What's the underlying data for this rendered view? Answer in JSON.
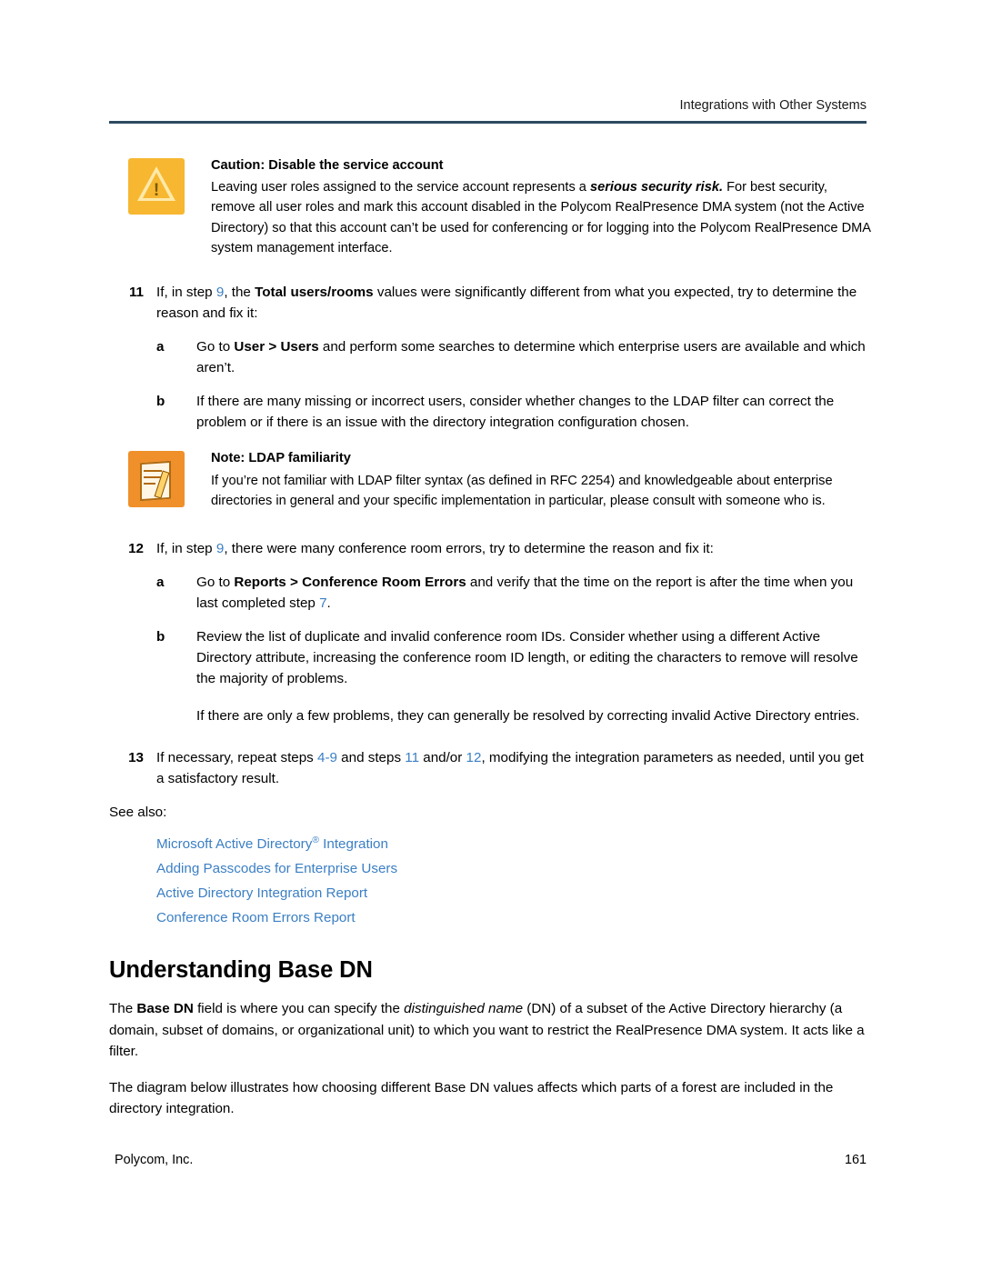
{
  "header": {
    "running_head": "Integrations with Other Systems"
  },
  "caution": {
    "icon": "warning-triangle-icon",
    "title": "Caution: Disable the service account",
    "body_1": "Leaving user roles assigned to the service account represents a ",
    "body_emph": "serious security risk.",
    "body_2": " For best security, remove all user roles and mark this account disabled in the Polycom RealPresence DMA system (not the Active Directory) so that this account can’t be used for conferencing or for logging into the Polycom RealPresence DMA system management interface."
  },
  "steps": {
    "s11": {
      "num": "11",
      "t1": "If, in step ",
      "xref": "9",
      "t2": ", the ",
      "bold": "Total users/rooms",
      "t3": " values were significantly different from what you expected, try to determine the reason and fix it:",
      "a": {
        "letter": "a",
        "t1": "Go to ",
        "bold": "User > Users",
        "t2": " and perform some searches to determine which enterprise users are available and which aren’t."
      },
      "b": {
        "letter": "b",
        "text": "If there are many missing or incorrect users, consider whether changes to the LDAP filter can correct the problem or if there is an issue with the directory integration configuration chosen."
      }
    },
    "s12": {
      "num": "12",
      "t1": "If, in step ",
      "xref": "9",
      "t2": ", there were many conference room errors, try to determine the reason and fix it:",
      "a": {
        "letter": "a",
        "t1": "Go to ",
        "bold": "Reports > Conference Room Errors",
        "t2": " and verify that the time on the report is after the time when you last completed step ",
        "xref": "7",
        "t3": "."
      },
      "b": {
        "letter": "b",
        "text": "Review the list of duplicate and invalid conference room IDs. Consider whether using a different Active Directory attribute, increasing the conference room ID length, or editing the characters to remove will resolve the majority of problems."
      },
      "extra": "If there are only a few problems, they can generally be resolved by correcting invalid Active Directory entries."
    },
    "s13": {
      "num": "13",
      "t1": "If necessary, repeat steps ",
      "xref1": "4-9",
      "t2": " and steps ",
      "xref2": "11",
      "t3": " and/or ",
      "xref3": "12",
      "t4": ", modifying the integration parameters as needed, until you get a satisfactory result."
    }
  },
  "note": {
    "icon": "note-pencil-icon",
    "title": "Note: LDAP familiarity",
    "body": "If you’re not familiar with LDAP filter syntax (as defined in RFC 2254) and knowledgeable about enterprise directories in general and your specific implementation in particular, please consult with someone who is."
  },
  "see_also": {
    "label": "See also:",
    "links": [
      {
        "text_1": "Microsoft Active Directory",
        "sup": "®",
        "text_2": " Integration"
      },
      {
        "text_1": "Adding Passcodes for Enterprise Users",
        "sup": "",
        "text_2": ""
      },
      {
        "text_1": "Active Directory Integration Report",
        "sup": "",
        "text_2": ""
      },
      {
        "text_1": "Conference Room Errors Report",
        "sup": "",
        "text_2": ""
      }
    ]
  },
  "section": {
    "heading": "Understanding Base DN",
    "para1_a": "The ",
    "para1_bold": "Base DN",
    "para1_b": " field is where you can specify the ",
    "para1_italic": "distinguished name",
    "para1_c": " (DN) of a subset of the Active Directory hierarchy (a domain, subset of domains, or organizational unit) to which you want to restrict the RealPresence DMA system. It acts like a filter.",
    "para2": "The diagram below illustrates how choosing different Base DN values affects which parts of a forest are included in the directory integration."
  },
  "footer": {
    "company": "Polycom, Inc.",
    "page_number": "161"
  },
  "colors": {
    "link": "#3b7fc4",
    "rule": "#2e4a62",
    "caution_icon": "#f7b731",
    "note_icon": "#f0902a"
  }
}
